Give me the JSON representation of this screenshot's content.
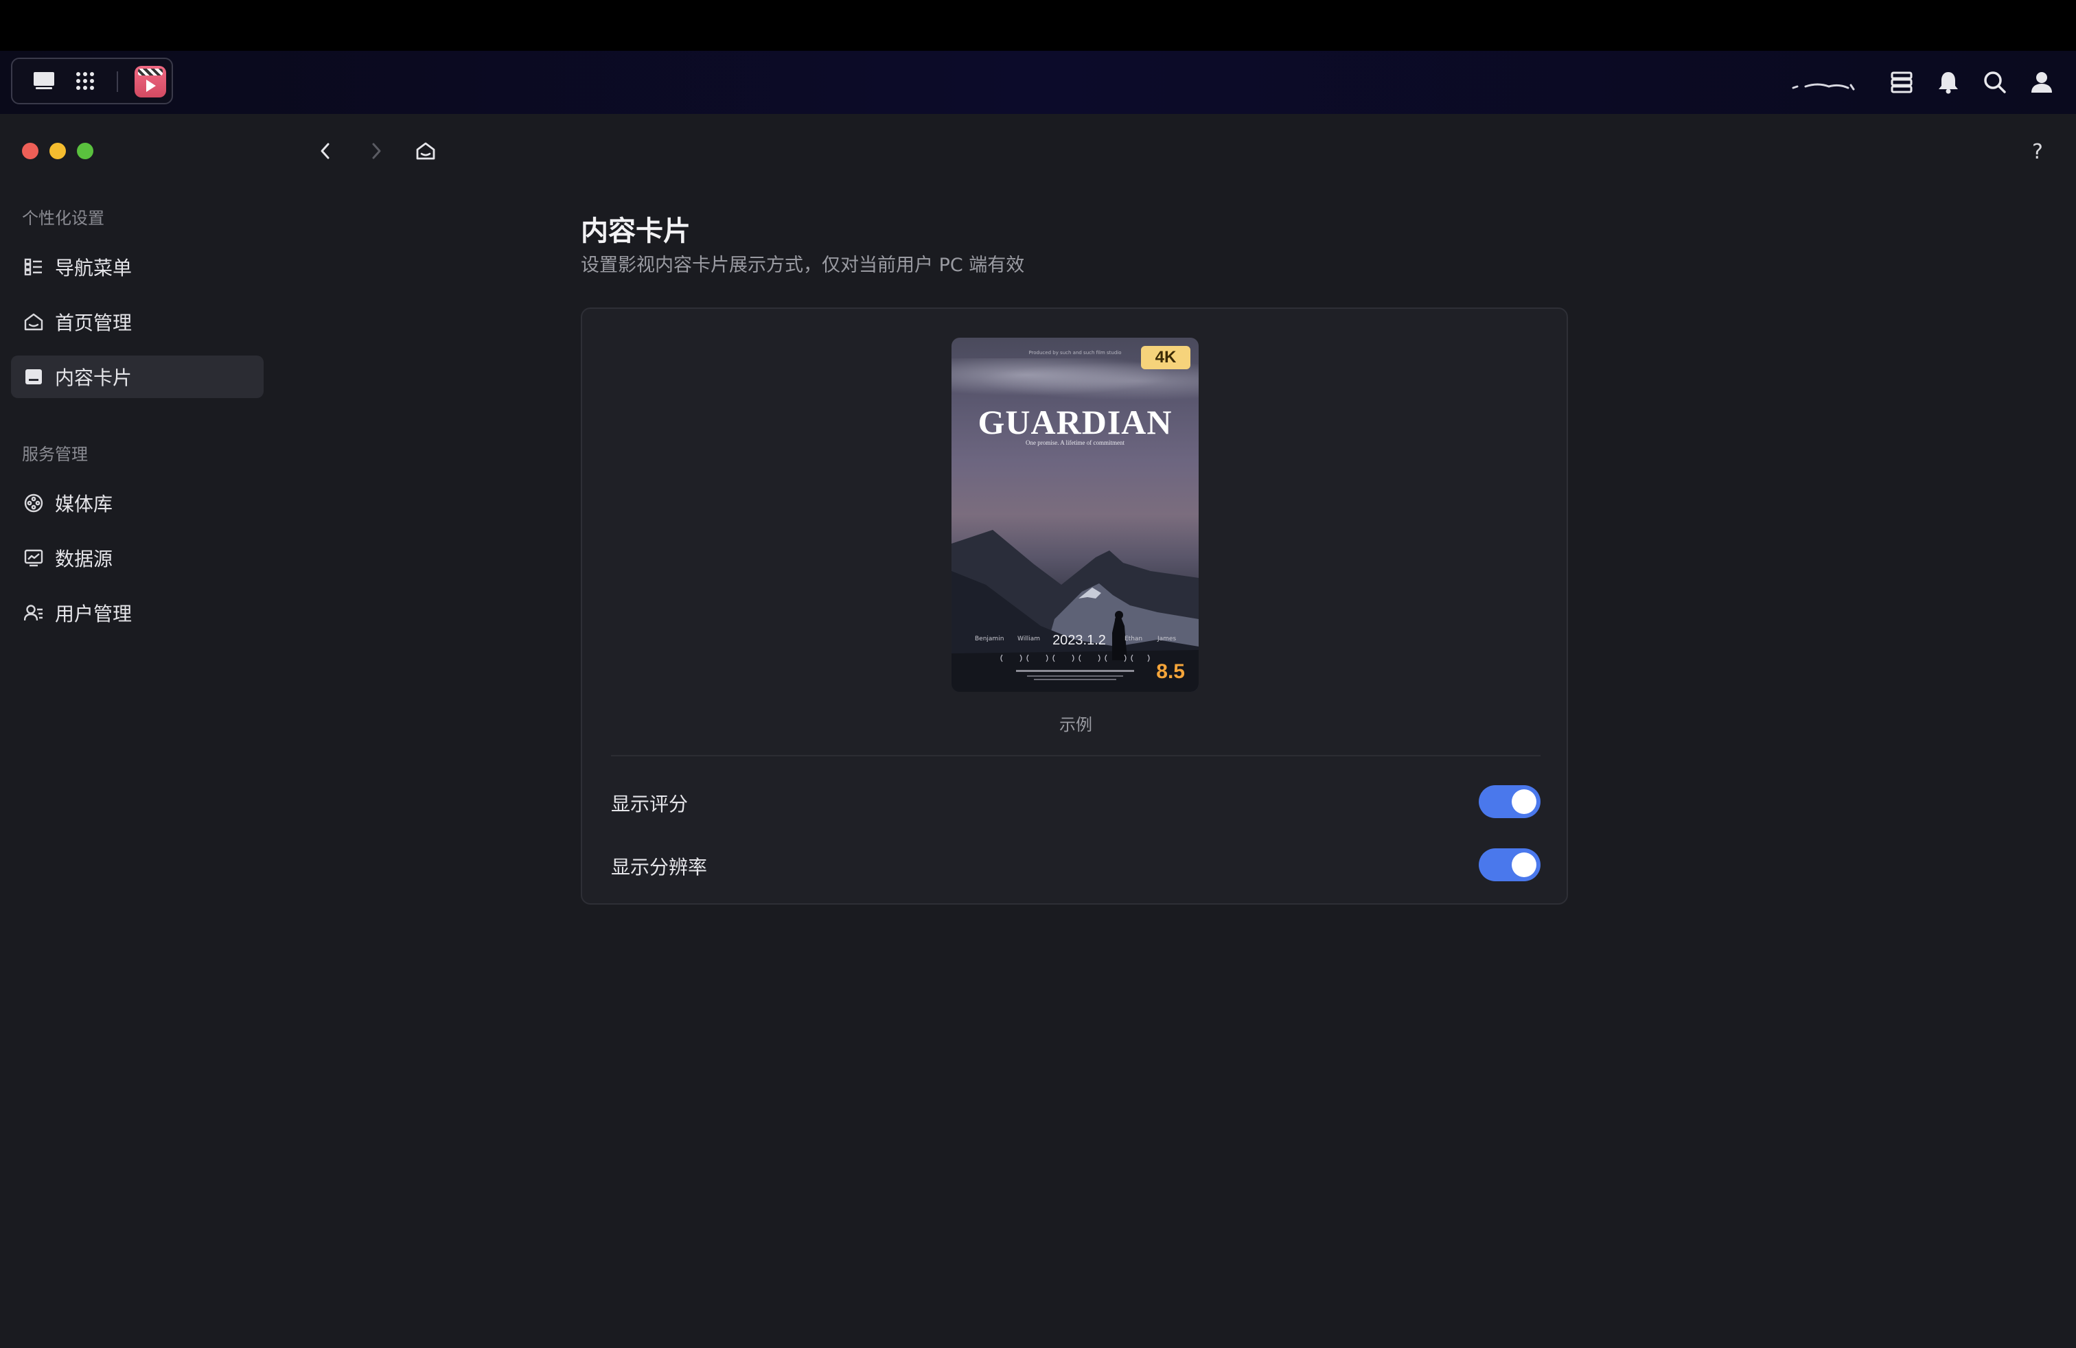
{
  "topbar": {
    "icons": [
      "desktop-icon",
      "apps-grid-icon",
      "video-app-icon",
      "server-icon",
      "bell-icon",
      "search-icon",
      "user-icon"
    ]
  },
  "window": {
    "nav": {
      "back": "chevron-left-icon",
      "forward": "chevron-right-icon",
      "home": "home-icon"
    },
    "help_label": "?"
  },
  "sidebar": {
    "groups": [
      {
        "title": "个性化设置",
        "items": [
          {
            "label": "导航菜单",
            "icon": "list-icon"
          },
          {
            "label": "首页管理",
            "icon": "home-icon"
          },
          {
            "label": "内容卡片",
            "icon": "card-icon",
            "active": true
          }
        ]
      },
      {
        "title": "服务管理",
        "items": [
          {
            "label": "媒体库",
            "icon": "film-reel-icon"
          },
          {
            "label": "数据源",
            "icon": "chart-icon"
          },
          {
            "label": "用户管理",
            "icon": "users-icon"
          }
        ]
      }
    ]
  },
  "main": {
    "title": "内容卡片",
    "subtitle": "设置影视内容卡片展示方式，仅对当前用户 PC 端有效",
    "preview": {
      "badge": "4K",
      "poster_title": "GUARDIAN",
      "poster_tagline": "One promise. A lifetime of commitment",
      "poster_producer": "Produced by such and such film studio",
      "credits": [
        "Benjamin",
        "William",
        "Ethan",
        "James"
      ],
      "date": "2023.1.2",
      "rating": "8.5",
      "caption": "示例"
    },
    "settings": [
      {
        "label": "显示评分",
        "enabled": true
      },
      {
        "label": "显示分辨率",
        "enabled": true
      }
    ],
    "colors": {
      "accent": "#4a78ec",
      "rating": "#f5a53a",
      "badge": "#f6d37b"
    }
  }
}
